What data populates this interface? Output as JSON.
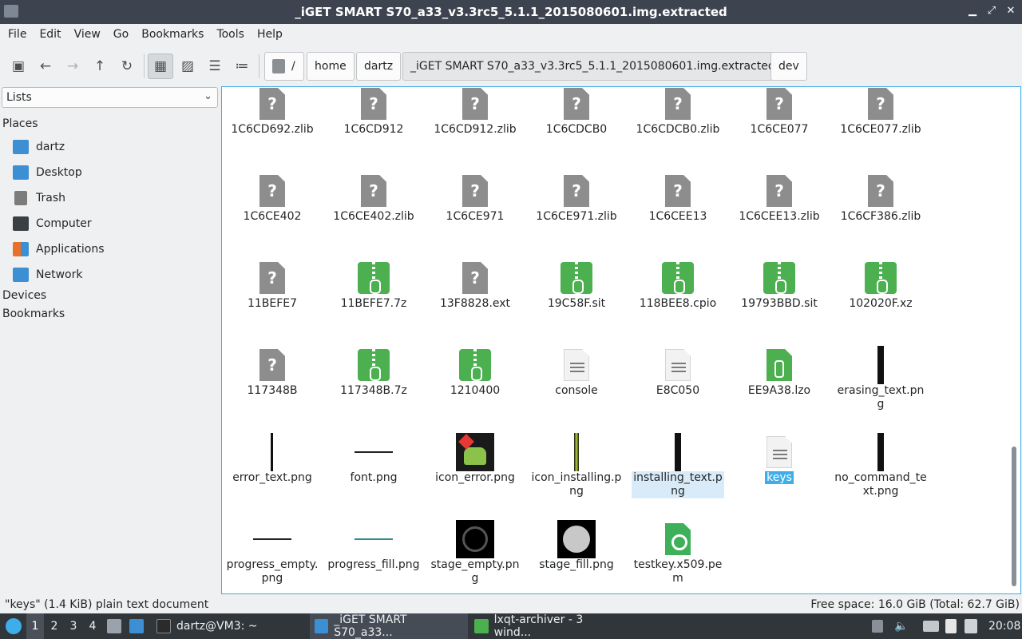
{
  "window": {
    "title": "_iGET SMART S70_a33_v3.3rc5_5.1.1_2015080601.img.extracted"
  },
  "menu": [
    "File",
    "Edit",
    "View",
    "Go",
    "Bookmarks",
    "Tools",
    "Help"
  ],
  "toolbar": {
    "buttons": [
      "new-tab",
      "back",
      "forward",
      "up",
      "reload",
      "icon-view",
      "thumbnail-view",
      "compact-view",
      "detailed-list-view"
    ],
    "view_mode": "icon-view"
  },
  "path": {
    "root": "/",
    "crumbs": [
      "home",
      "dartz",
      "_iGET SMART S70_a33_v3.3rc5_5.1.1_2015080601.img.extracted",
      "dev"
    ],
    "current_index": 2
  },
  "side": {
    "selector": "Lists",
    "places_header": "Places",
    "places": [
      {
        "label": "dartz",
        "icon": "home-folder-icon",
        "color": "#3d8fd4"
      },
      {
        "label": "Desktop",
        "icon": "desktop-icon",
        "color": "#3d8fd4"
      },
      {
        "label": "Trash",
        "icon": "trash-icon",
        "color": "#7c7c7c"
      },
      {
        "label": "Computer",
        "icon": "computer-icon",
        "color": "#3a3f44"
      },
      {
        "label": "Applications",
        "icon": "applications-icon",
        "color": "#e8702a"
      },
      {
        "label": "Network",
        "icon": "network-icon",
        "color": "#3d8fd4"
      }
    ],
    "devices_header": "Devices",
    "bookmarks_header": "Bookmarks"
  },
  "files": [
    {
      "name": "1C6CD692.zlib",
      "type": "unknown"
    },
    {
      "name": "1C6CD912",
      "type": "unknown"
    },
    {
      "name": "1C6CD912.zlib",
      "type": "unknown"
    },
    {
      "name": "1C6CDCB0",
      "type": "unknown"
    },
    {
      "name": "1C6CDCB0.zlib",
      "type": "unknown"
    },
    {
      "name": "1C6CE077",
      "type": "unknown"
    },
    {
      "name": "1C6CE077.zlib",
      "type": "unknown"
    },
    {
      "name": "1C6CE402",
      "type": "unknown"
    },
    {
      "name": "1C6CE402.zlib",
      "type": "unknown"
    },
    {
      "name": "1C6CE971",
      "type": "unknown"
    },
    {
      "name": "1C6CE971.zlib",
      "type": "unknown"
    },
    {
      "name": "1C6CEE13",
      "type": "unknown"
    },
    {
      "name": "1C6CEE13.zlib",
      "type": "unknown"
    },
    {
      "name": "1C6CF386.zlib",
      "type": "unknown"
    },
    {
      "name": "11BEFE7",
      "type": "unknown"
    },
    {
      "name": "11BEFE7.7z",
      "type": "archive"
    },
    {
      "name": "13F8828.ext",
      "type": "unknown"
    },
    {
      "name": "19C58F.sit",
      "type": "archive"
    },
    {
      "name": "118BEE8.cpio",
      "type": "archive"
    },
    {
      "name": "19793BBD.sit",
      "type": "archive"
    },
    {
      "name": "102020F.xz",
      "type": "archive"
    },
    {
      "name": "117348B",
      "type": "unknown"
    },
    {
      "name": "117348B.7z",
      "type": "archive"
    },
    {
      "name": "1210400",
      "type": "archive"
    },
    {
      "name": "console",
      "type": "text"
    },
    {
      "name": "E8C050",
      "type": "text"
    },
    {
      "name": "EE9A38.lzo",
      "type": "lzo"
    },
    {
      "name": "erasing_text.png",
      "type": "image-tall"
    },
    {
      "name": "error_text.png",
      "type": "image-line-vert"
    },
    {
      "name": "font.png",
      "type": "image-line-horiz"
    },
    {
      "name": "icon_error.png",
      "type": "image-android"
    },
    {
      "name": "icon_installing.png",
      "type": "image-installing"
    },
    {
      "name": "installing_text.png",
      "type": "image-tall",
      "hover": true
    },
    {
      "name": "keys",
      "type": "text",
      "selected": true
    },
    {
      "name": "no_command_text.png",
      "type": "image-tall"
    },
    {
      "name": "progress_empty.png",
      "type": "image-line-horiz"
    },
    {
      "name": "progress_fill.png",
      "type": "image-line-teal"
    },
    {
      "name": "stage_empty.png",
      "type": "image-ring"
    },
    {
      "name": "stage_fill.png",
      "type": "image-disc"
    },
    {
      "name": "testkey.x509.pem",
      "type": "certificate"
    }
  ],
  "status": {
    "left": "\"keys\" (1.4 KiB) plain text document",
    "right": "Free space: 16.0 GiB (Total: 62.7 GiB)"
  },
  "taskbar": {
    "desktops": [
      "1",
      "2",
      "3",
      "4"
    ],
    "active_desktop": "1",
    "tasks": [
      {
        "label": "dartz@VM3: ~",
        "icon": "terminal-icon"
      },
      {
        "label": "_iGET SMART S70_a33...",
        "icon": "folder-icon",
        "active": true
      },
      {
        "label": "lxqt-archiver - 3 wind...",
        "icon": "archiver-icon"
      }
    ],
    "clock": "20:08"
  }
}
